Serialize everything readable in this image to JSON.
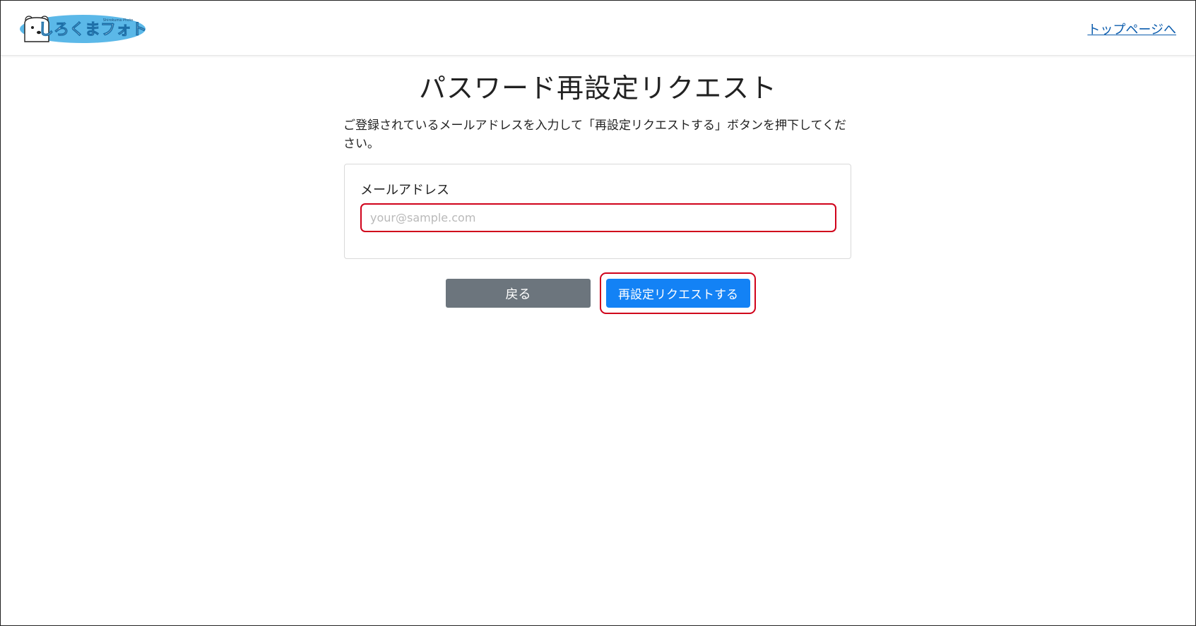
{
  "header": {
    "logo": {
      "text": "しろくまフォト",
      "subtext": "Shirokuma Photo",
      "icon": "polar-bear-icon",
      "bg_color": "#5bb8e8"
    },
    "top_link_label": "トップページへ"
  },
  "main": {
    "title": "パスワード再設定リクエスト",
    "description": "ご登録されているメールアドレスを入力して「再設定リクエストする」ボタンを押下してください。",
    "form": {
      "email_label": "メールアドレス",
      "email_value": "",
      "email_placeholder": "your@sample.com"
    },
    "buttons": {
      "back_label": "戻る",
      "submit_label": "再設定リクエストする"
    }
  },
  "colors": {
    "highlight": "#d0021b",
    "primary": "#1382f5",
    "secondary": "#6c757d",
    "link": "#0b5cad"
  }
}
